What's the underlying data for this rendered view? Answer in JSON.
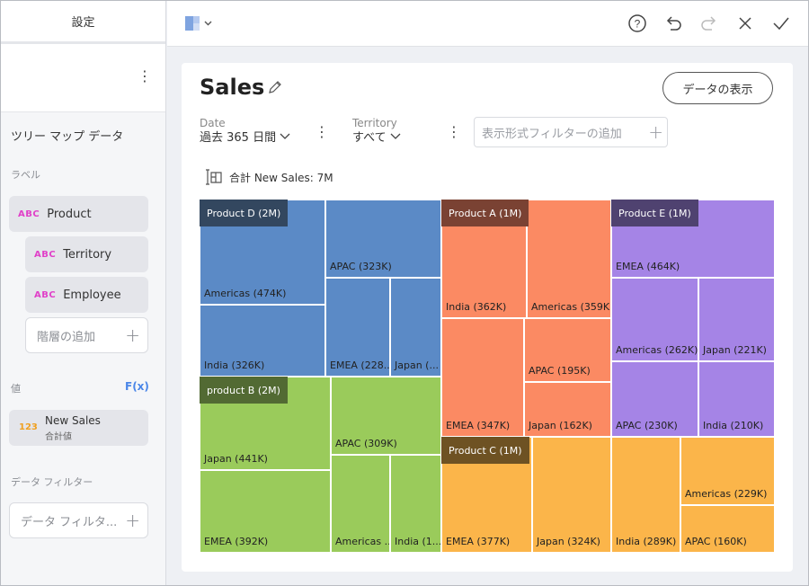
{
  "left_panel": {
    "header": "設定",
    "vis_title": "ツリー マップ データ",
    "labels_section": "ラベル",
    "label_items": [
      {
        "tag": "ABC",
        "label": "Product"
      },
      {
        "tag": "ABC",
        "label": "Territory"
      },
      {
        "tag": "ABC",
        "label": "Employee"
      }
    ],
    "add_hierarchy": "階層の追加",
    "values_section": "値",
    "fx": "F(x)",
    "value_item": {
      "tag": "123",
      "label": "New Sales",
      "sub": "合計値"
    },
    "data_filter_section": "データ フィルター",
    "data_filter_placeholder": "データ フィルタ...",
    "colors": {
      "abc_tag": "#e040c8",
      "num_tag": "#f0a020",
      "fx": "#4a86e8"
    }
  },
  "toolbar": {
    "icons": [
      "visualization-icon",
      "help-icon",
      "undo-icon",
      "redo-icon",
      "close-icon",
      "check-icon"
    ]
  },
  "dashboard": {
    "title": "Sales",
    "show_data_button": "データの表示",
    "filters": [
      {
        "label": "Date",
        "value": "過去 365 日間"
      },
      {
        "label": "Territory",
        "value": "すべて"
      }
    ],
    "add_filter_placeholder": "表示形式フィルターの追加",
    "total": "合計 New Sales: 7M"
  },
  "treemap": {
    "groups": [
      {
        "label": "Product D (2M)",
        "color": "#5b8ac6",
        "header": "#33475f"
      },
      {
        "label": "product B (2M)",
        "color": "#9acb5b",
        "header": "#526a33"
      },
      {
        "label": "Product A (1M)",
        "color": "#fb8a63",
        "header": "#7a4233"
      },
      {
        "label": "Product C (1M)",
        "color": "#fbb54a",
        "header": "#6e5223"
      },
      {
        "label": "Product E (1M)",
        "color": "#a584e6",
        "header": "#4f4270"
      }
    ],
    "cells": [
      {
        "label": "Americas (474K)",
        "group": 0
      },
      {
        "label": "India (326K)",
        "group": 0
      },
      {
        "label": "APAC (323K)",
        "group": 0
      },
      {
        "label": "EMEA (228...",
        "group": 0
      },
      {
        "label": "Japan (...",
        "group": 0
      },
      {
        "label": "Japan (441K)",
        "group": 1
      },
      {
        "label": "EMEA (392K)",
        "group": 1
      },
      {
        "label": "APAC (309K)",
        "group": 1
      },
      {
        "label": "Americas ...",
        "group": 1
      },
      {
        "label": "India (1...",
        "group": 1
      },
      {
        "label": "India (362K)",
        "group": 2
      },
      {
        "label": "Americas (359K)",
        "group": 2
      },
      {
        "label": "EMEA (347K)",
        "group": 2
      },
      {
        "label": "APAC (195K)",
        "group": 2
      },
      {
        "label": "Japan (162K)",
        "group": 2
      },
      {
        "label": "EMEA (377K)",
        "group": 3
      },
      {
        "label": "Japan (324K)",
        "group": 3
      },
      {
        "label": "India (289K)",
        "group": 3
      },
      {
        "label": "Americas (229K)",
        "group": 3
      },
      {
        "label": "APAC (160K)",
        "group": 3
      },
      {
        "label": "EMEA (464K)",
        "group": 4
      },
      {
        "label": "Americas (262K)",
        "group": 4
      },
      {
        "label": "Japan (221K)",
        "group": 4
      },
      {
        "label": "APAC (230K)",
        "group": 4
      },
      {
        "label": "India (210K)",
        "group": 4
      }
    ]
  }
}
